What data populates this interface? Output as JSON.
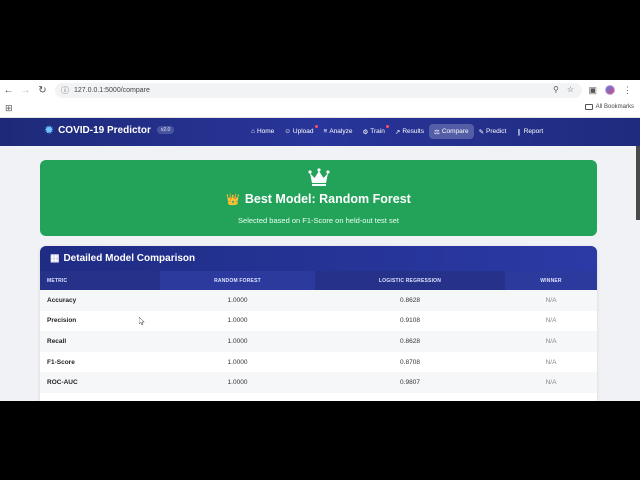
{
  "browser": {
    "url": "127.0.0.1:5000/compare",
    "bookmarks_label": "All Bookmarks"
  },
  "app": {
    "brand": "COVID-19 Predictor",
    "version": "v2.0",
    "nav": [
      {
        "label": "Home",
        "icon": "home-icon",
        "dot": false,
        "active": false
      },
      {
        "label": "Upload",
        "icon": "upload-icon",
        "dot": true,
        "active": false
      },
      {
        "label": "Analyze",
        "icon": "chart-icon",
        "dot": false,
        "active": false
      },
      {
        "label": "Train",
        "icon": "robot-icon",
        "dot": true,
        "active": false
      },
      {
        "label": "Results",
        "icon": "line-chart-icon",
        "dot": false,
        "active": false
      },
      {
        "label": "Compare",
        "icon": "balance-icon",
        "dot": false,
        "active": true
      },
      {
        "label": "Predict",
        "icon": "pencil-icon",
        "dot": false,
        "active": false
      },
      {
        "label": "Report",
        "icon": "file-icon",
        "dot": false,
        "active": false
      }
    ]
  },
  "best_model": {
    "emoji": "👑",
    "title": "Best Model: Random Forest",
    "subtitle": "Selected based on F1-Score on held-out test set",
    "color": "#23a35a"
  },
  "comparison": {
    "title": "Detailed Model Comparison",
    "columns": [
      "METRIC",
      "RANDOM FOREST",
      "LOGISTIC REGRESSION",
      "WINNER"
    ],
    "rows": [
      {
        "metric": "Accuracy",
        "rf": "1.0000",
        "lr": "0.8628",
        "winner": "N/A"
      },
      {
        "metric": "Precision",
        "rf": "1.0000",
        "lr": "0.9108",
        "winner": "N/A"
      },
      {
        "metric": "Recall",
        "rf": "1.0000",
        "lr": "0.8628",
        "winner": "N/A"
      },
      {
        "metric": "F1-Score",
        "rf": "1.0000",
        "lr": "0.8708",
        "winner": "N/A"
      },
      {
        "metric": "ROC-AUC",
        "rf": "1.0000",
        "lr": "0.9807",
        "winner": "N/A"
      }
    ]
  }
}
